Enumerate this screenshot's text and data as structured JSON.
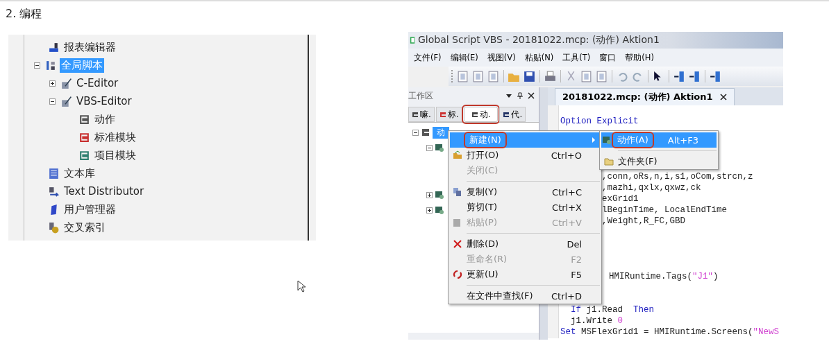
{
  "heading": "2. 编程",
  "tree": [
    {
      "label": "报表编辑器",
      "selected": false
    },
    {
      "label": "全局脚本",
      "selected": true,
      "expanded": true,
      "children": [
        {
          "label": "C-Editor",
          "selected": false,
          "expanded": false
        },
        {
          "label": "VBS-Editor",
          "selected": false,
          "expanded": true,
          "children": [
            {
              "label": "动作",
              "selected": false
            },
            {
              "label": "标准模块",
              "selected": false
            },
            {
              "label": "项目模块",
              "selected": false
            }
          ]
        }
      ]
    },
    {
      "label": "文本库",
      "selected": false
    },
    {
      "label": "Text Distributor",
      "selected": false
    },
    {
      "label": "用户管理器",
      "selected": false
    },
    {
      "label": "交叉索引",
      "selected": false
    }
  ],
  "window": {
    "title": "Global Script VBS - 20181022.mcp: (动作) Aktion1",
    "menu": [
      "文件(F)",
      "编辑(E)",
      "视图(V)",
      "粘贴(N)",
      "工具(T)",
      "窗口",
      "帮助(H)"
    ],
    "workspace": {
      "title": "工作区",
      "tabs": [
        {
          "label": "嘛.",
          "selected": false,
          "annotated": false
        },
        {
          "label": "标.",
          "selected": false,
          "annotated": false
        },
        {
          "label": "动.",
          "selected": true,
          "annotated": true
        },
        {
          "label": "代.",
          "selected": false,
          "annotated": false
        }
      ],
      "root": {
        "label": "动",
        "selected": true
      }
    },
    "editor": {
      "tab": "20181022.mcp: (动作) Aktion1",
      "lines": [
        {
          "kind": "full",
          "segments": [
            {
              "kind": "keyword",
              "text": "Option Explicit"
            }
          ]
        },
        {
          "kind": "blank"
        },
        {
          "kind": "blank"
        },
        {
          "kind": "blank"
        },
        {
          "kind": "blank"
        },
        {
          "kind": "tail",
          "segments": [
            {
              "kind": "plain",
              "text": ",conn,oRs,n,i,s1,oCom,strcn,z"
            }
          ]
        },
        {
          "kind": "tail",
          "segments": [
            {
              "kind": "plain",
              "text": ",mazhi,qxlx,qxwz,ck"
            }
          ]
        },
        {
          "kind": "tail",
          "segments": [
            {
              "kind": "plain",
              "text": "exGrid1"
            }
          ]
        },
        {
          "kind": "tail",
          "segments": [
            {
              "kind": "plain",
              "text": "lBeginTime, LocalEndTime"
            }
          ]
        },
        {
          "kind": "tail",
          "segments": [
            {
              "kind": "plain",
              "text": ",Weight,R_FC,GBD"
            }
          ]
        },
        {
          "kind": "blank"
        },
        {
          "kind": "blank"
        },
        {
          "kind": "blank"
        },
        {
          "kind": "blank"
        },
        {
          "kind": "tail2",
          "segments": [
            {
              "kind": "plain",
              "text": "HMIRuntime.Tags("
            },
            {
              "kind": "string",
              "text": "\"J1\""
            },
            {
              "kind": "plain",
              "text": ")"
            }
          ]
        },
        {
          "kind": "blank"
        },
        {
          "kind": "blank"
        },
        {
          "kind": "indented",
          "segments": [
            {
              "kind": "keyword",
              "text": "If"
            },
            {
              "kind": "plain",
              "text": " j1.Read  "
            },
            {
              "kind": "keyword",
              "text": "Then"
            }
          ]
        },
        {
          "kind": "indented",
          "segments": [
            {
              "kind": "plain",
              "text": "j1.Write "
            },
            {
              "kind": "string",
              "text": "0"
            }
          ]
        },
        {
          "kind": "full",
          "segments": [
            {
              "kind": "keyword",
              "text": "Set"
            },
            {
              "kind": "plain",
              "text": " MSFlexGrid1 = HMIRuntime.Screens("
            },
            {
              "kind": "string",
              "text": "\"NewS"
            }
          ]
        }
      ]
    }
  },
  "context_menu": [
    {
      "kind": "item",
      "label": "新建(N)",
      "submenu": true,
      "selected": true,
      "disabled": false,
      "annotated": true
    },
    {
      "kind": "item",
      "label": "打开(O)",
      "shortcut": "Ctrl+O",
      "submenu": false,
      "selected": false,
      "disabled": false,
      "annotated": false
    },
    {
      "kind": "item",
      "label": "关闭(C)",
      "submenu": false,
      "selected": false,
      "disabled": true,
      "annotated": false
    },
    {
      "kind": "separator"
    },
    {
      "kind": "item",
      "label": "复制(Y)",
      "shortcut": "Ctrl+C",
      "submenu": false,
      "selected": false,
      "disabled": false,
      "annotated": false
    },
    {
      "kind": "item",
      "label": "剪切(T)",
      "shortcut": "Ctrl+X",
      "submenu": false,
      "selected": false,
      "disabled": false,
      "annotated": false
    },
    {
      "kind": "item",
      "label": "粘贴(P)",
      "shortcut": "Ctrl+V",
      "submenu": false,
      "selected": false,
      "disabled": true,
      "annotated": false
    },
    {
      "kind": "separator"
    },
    {
      "kind": "item",
      "label": "删除(D)",
      "shortcut": "Del",
      "submenu": false,
      "selected": false,
      "disabled": false,
      "annotated": false
    },
    {
      "kind": "item",
      "label": "重命名(R)",
      "shortcut": "F2",
      "submenu": false,
      "selected": false,
      "disabled": true,
      "annotated": false
    },
    {
      "kind": "item",
      "label": "更新(U)",
      "shortcut": "F5",
      "submenu": false,
      "selected": false,
      "disabled": false,
      "annotated": false
    },
    {
      "kind": "separator"
    },
    {
      "kind": "item",
      "label": "在文件中查找(F)",
      "shortcut": "Ctrl+D",
      "submenu": false,
      "selected": false,
      "disabled": false,
      "annotated": false
    }
  ],
  "submenu": [
    {
      "kind": "item",
      "label": "动作(A)",
      "shortcut": "Alt+F3",
      "selected": true,
      "annotated": true
    },
    {
      "kind": "separator"
    },
    {
      "kind": "item",
      "label": "文件夹(F)",
      "selected": false,
      "annotated": false
    }
  ]
}
